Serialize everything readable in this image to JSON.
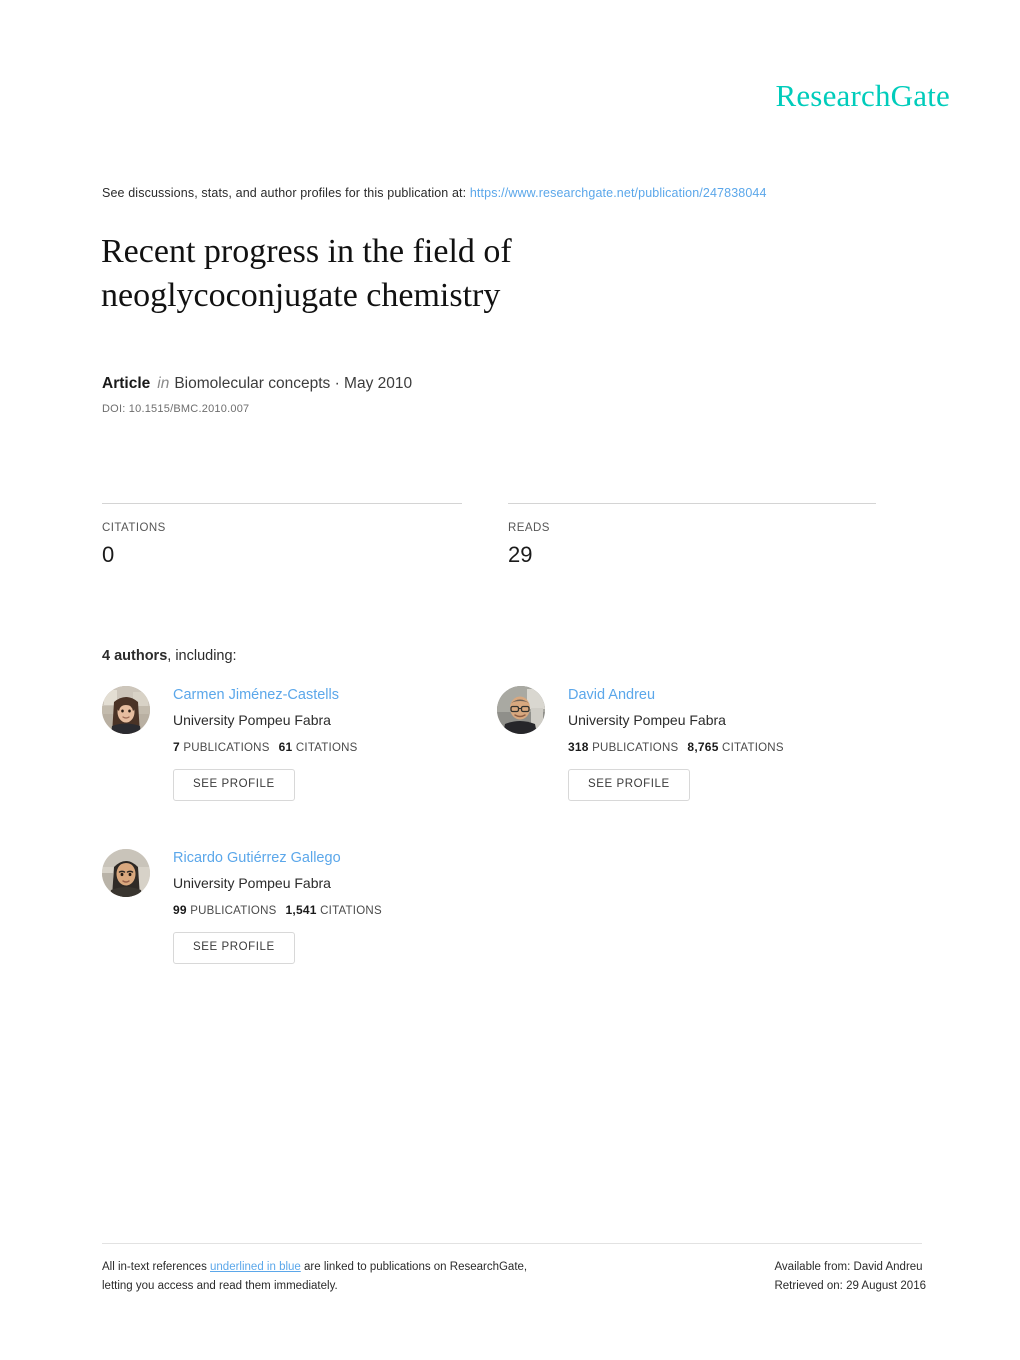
{
  "brand": {
    "name": "ResearchGate",
    "color": "#00ccbb"
  },
  "discussion": {
    "prefix": "See discussions, stats, and author profiles for this publication at:",
    "url": "https://www.researchgate.net/publication/247838044"
  },
  "publication": {
    "title_line1": "Recent progress in the field of",
    "title_line2": "neoglycoconjugate chemistry",
    "type": "Article",
    "in_word": "in",
    "venue_and_date": "Biomolecular concepts · May 2010",
    "doi": "DOI: 10.1515/BMC.2010.007"
  },
  "stats": [
    {
      "label": "CITATIONS",
      "value": "0"
    },
    {
      "label": "READS",
      "value": "29"
    }
  ],
  "authors_section": {
    "count_label": "4 authors",
    "including_label": ", including:",
    "see_profile_label": "SEE PROFILE",
    "publications_word": "PUBLICATIONS",
    "citations_word": "CITATIONS",
    "authors": [
      {
        "name": "Carmen Jiménez-Castells",
        "affiliation": "University Pompeu Fabra",
        "publications": "7",
        "citations": "61"
      },
      {
        "name": "David Andreu",
        "affiliation": "University Pompeu Fabra",
        "publications": "318",
        "citations": "8,765"
      },
      {
        "name": "Ricardo Gutiérrez Gallego",
        "affiliation": "University Pompeu Fabra",
        "publications": "99",
        "citations": "1,541"
      }
    ]
  },
  "footer": {
    "left_line1_a": "All in-text references ",
    "left_line1_link": "underlined in blue",
    "left_line1_b": " are linked to publications on ResearchGate,",
    "left_line2": "letting you access and read them immediately.",
    "right_line1": "Available from: David Andreu",
    "right_line2": "Retrieved on: 29 August 2016"
  }
}
